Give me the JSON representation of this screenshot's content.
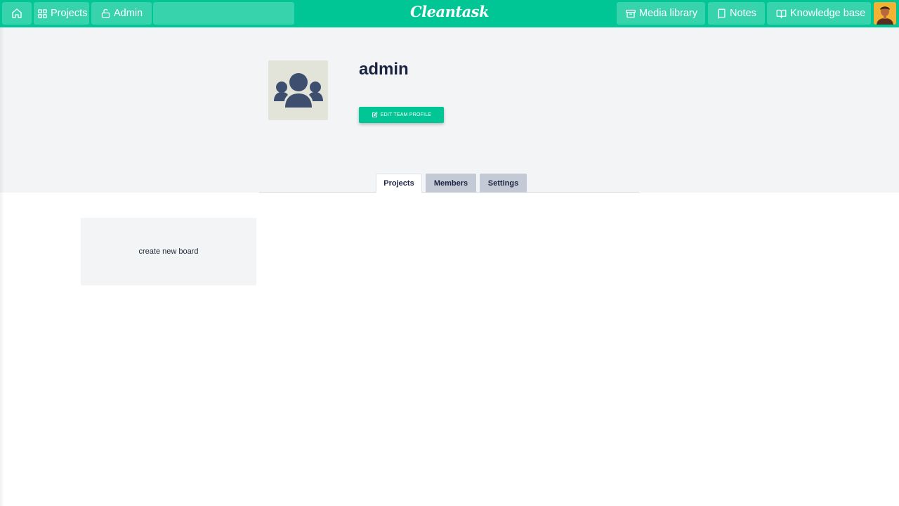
{
  "app": {
    "logo": "Cleantask"
  },
  "nav": {
    "home_icon": "home-icon",
    "projects_label": "Projects",
    "admin_label": "Admin",
    "search_value": "",
    "media_library_label": "Media library",
    "notes_label": "Notes",
    "knowledge_base_label": "Knowledge base"
  },
  "team": {
    "name": "admin",
    "edit_label": "EDIT TEAM PROFILE"
  },
  "tabs": [
    {
      "label": "Projects",
      "active": true
    },
    {
      "label": "Members",
      "active": false
    },
    {
      "label": "Settings",
      "active": false
    }
  ],
  "boards": {
    "create_label": "create new board"
  },
  "colors": {
    "brand": "#00c595",
    "nav_button": "#37d3ad",
    "header_bg": "#f3f4f6",
    "team_avatar_bg": "#e2e3d9",
    "team_icon": "#3d4e6f",
    "tab_inactive": "#c3cad5",
    "title_text": "#1a2340"
  }
}
